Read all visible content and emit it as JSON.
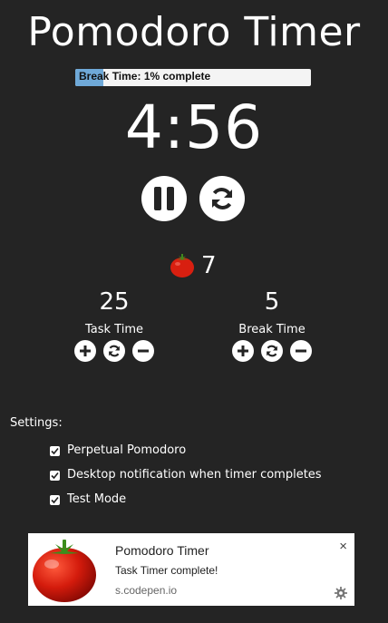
{
  "app": {
    "title": "Pomodoro Timer"
  },
  "progress": {
    "label": "Break Time:  1% complete",
    "percent": 12
  },
  "timer": {
    "display": "4:56"
  },
  "controls": {
    "pause_icon": "pause-icon",
    "reset_icon": "refresh-icon"
  },
  "pomodoros": {
    "icon": "tomato-icon",
    "count": "7"
  },
  "task": {
    "value": "25",
    "label": "Task Time"
  },
  "break": {
    "value": "5",
    "label": "Break Time"
  },
  "settings": {
    "label": "Settings:",
    "items": [
      {
        "label": "Perpetual Pomodoro",
        "checked": true
      },
      {
        "label": "Desktop notification when timer completes",
        "checked": true
      },
      {
        "label": "Test Mode",
        "checked": true
      }
    ]
  },
  "notification": {
    "title": "Pomodoro Timer",
    "message": "Task Timer complete!",
    "source": "s.codepen.io",
    "close": "×"
  },
  "colors": {
    "background": "#242424",
    "progress_fill": "#6fa9d8",
    "tomato": "#d81f10"
  }
}
